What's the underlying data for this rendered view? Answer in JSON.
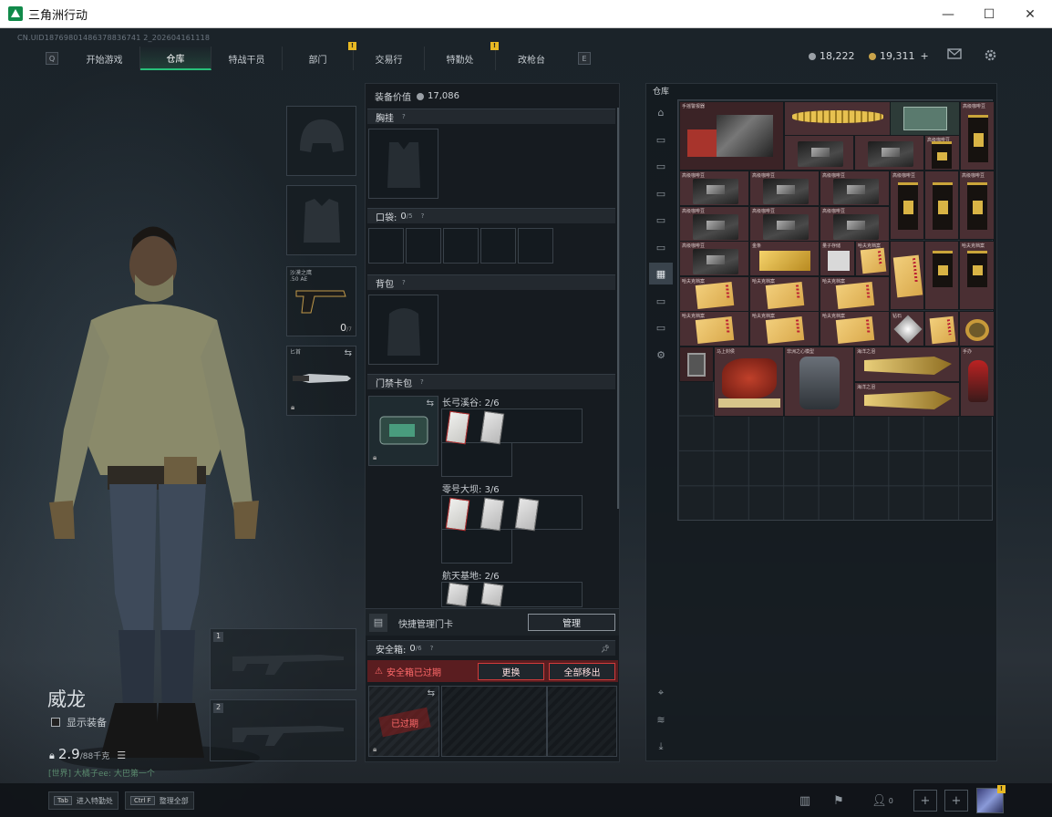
{
  "window": {
    "title": "三角洲行动",
    "min": "—",
    "max": "☐",
    "close": "✕"
  },
  "uid": "CN.UID18769801486378836741 2_202604161118",
  "nav": {
    "left_key": "Q",
    "right_key": "E",
    "tabs": [
      {
        "label": "开始游戏",
        "alert": false
      },
      {
        "label": "仓库",
        "alert": false,
        "active": true
      },
      {
        "label": "特战干员",
        "alert": false
      },
      {
        "label": "部门",
        "alert": true
      },
      {
        "label": "交易行",
        "alert": false
      },
      {
        "label": "特勤处",
        "alert": true
      },
      {
        "label": "改枪台",
        "alert": false
      }
    ],
    "alert_glyph": "!"
  },
  "currency": {
    "hafcoin": "18,222",
    "bound": "19,311",
    "plus": "+"
  },
  "colors": {
    "accent": "#27c07a",
    "alert": "#e8b923",
    "danger": "#d23b3b",
    "item_bg": "#4a2f33"
  },
  "character": {
    "name": "威龙",
    "show_equipment": "显示装备",
    "weight_value": "2.9",
    "weight_limit": "/88千克",
    "chat": "[世界] 大橘子ee: 大巴第一个"
  },
  "slots": {
    "primary_label": "1",
    "secondary_label": "2",
    "pistol_name": "沙漠之鹰",
    "pistol_sub": ".50 AE",
    "pistol_ammo": "0",
    "pistol_ammo_unit": "/7",
    "melee_name": "匕首"
  },
  "equipment": {
    "value_label": "装备价值",
    "value": "17,086",
    "chest_rig": "胸挂",
    "pocket": "口袋:",
    "pocket_count": "0",
    "pocket_total": "/5",
    "backpack": "背包",
    "keycard": "门禁卡包",
    "maps": [
      {
        "name": "长弓溪谷",
        "count": "2/6"
      },
      {
        "name": "零号大坝",
        "count": "3/6"
      },
      {
        "name": "航天基地",
        "count": "2/6"
      }
    ],
    "quick_manage": "快捷管理门卡",
    "manage_btn": "管理",
    "safebox": "安全箱:",
    "safebox_count": "0",
    "safebox_total": "/6",
    "safebox_expired": "安全箱已过期",
    "replace_btn": "更换",
    "move_all_btn": "全部移出",
    "expired_tag": "已过期",
    "help": "?"
  },
  "stash": {
    "title": "仓库",
    "items": {
      "hand_cart": "手摇警报器",
      "gold_crown": "",
      "coffee": "高级咖啡豆",
      "gold_bar": "金条",
      "tooth": "量子存储",
      "ledger": "哈夫克档案",
      "diamond": "钻石",
      "watch": "",
      "antique": "马上封侯",
      "robot": "非洲之心模型",
      "pistol_gold": "海洋之泪",
      "figure": "手办"
    }
  },
  "bottom": {
    "tab_key": "Tab",
    "tab_label": "进入特勤处",
    "ctrl_key": "Ctrl F",
    "ctrl_label": "整理全部",
    "friends_count": "0",
    "plus": "+",
    "badge": "!"
  }
}
